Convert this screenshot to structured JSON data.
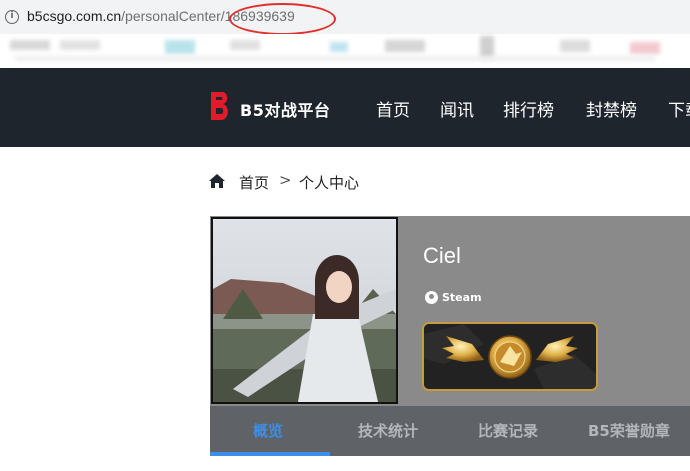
{
  "browser": {
    "url_host": "b5csgo.com.cn",
    "url_path": "/personalCenter/186939639",
    "highlight_color": "#e0302d",
    "info_icon": "info-icon"
  },
  "site": {
    "logo_icon": "b5-logo-icon",
    "logo_text": "B5对战平台",
    "brand_color": "#e21b2b",
    "nav": [
      "首页",
      "闻讯",
      "排行榜",
      "封禁榜",
      "下载"
    ]
  },
  "breadcrumb": {
    "home_icon": "home-icon",
    "home": "首页",
    "separator": ">",
    "current": "个人中心"
  },
  "profile": {
    "username": "Ciel",
    "platform_icon": "steam-icon",
    "platform": "Steam",
    "rank_icon": "rank-wings-badge-icon"
  },
  "tabs": {
    "active_index": 0,
    "items": [
      "概览",
      "技术统计",
      "比赛记录",
      "B5荣誉勋章"
    ],
    "accent": "#3d8ee8"
  }
}
